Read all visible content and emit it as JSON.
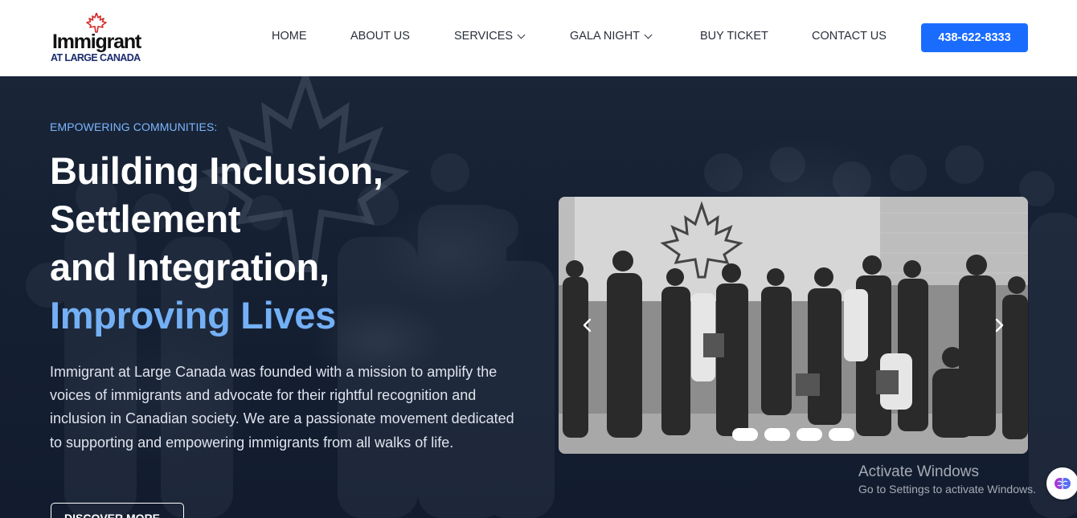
{
  "logo": {
    "main": "Immigrant",
    "sub": "AT LARGE CANADA"
  },
  "nav": {
    "items": [
      {
        "label": "HOME",
        "has_dropdown": false
      },
      {
        "label": "ABOUT US",
        "has_dropdown": false
      },
      {
        "label": "SERVICES",
        "has_dropdown": true
      },
      {
        "label": "GALA NIGHT",
        "has_dropdown": true
      },
      {
        "label": "BUY TICKET",
        "has_dropdown": false
      },
      {
        "label": "CONTACT US",
        "has_dropdown": false
      }
    ],
    "phone": "438-622-8333"
  },
  "hero": {
    "eyebrow": "EMPOWERING COMMUNITIES:",
    "headline_lines": [
      "Building Inclusion,",
      "Settlement",
      "and Integration,"
    ],
    "headline_accent": "Improving Lives",
    "paragraph": "Immigrant at Large Canada was founded with a mission to amplify the voices of immigrants and advocate for their rightful recognition and inclusion in Canadian society. We are a passionate movement dedicated to supporting and empowering immigrants from all walks of life.",
    "cta": "DISCOVER MORE →"
  },
  "carousel": {
    "slide_count": 4,
    "prev_icon": "chevron-left-icon",
    "next_icon": "chevron-right-icon"
  },
  "watermark": {
    "title": "Activate Windows",
    "subtitle": "Go to Settings to activate Windows."
  },
  "colors": {
    "accent_blue": "#1a6cff",
    "headline_accent": "#74b0f5",
    "eyebrow": "#7cb6ff",
    "maple_red": "#d42a2a",
    "hero_bg": "#152033"
  }
}
